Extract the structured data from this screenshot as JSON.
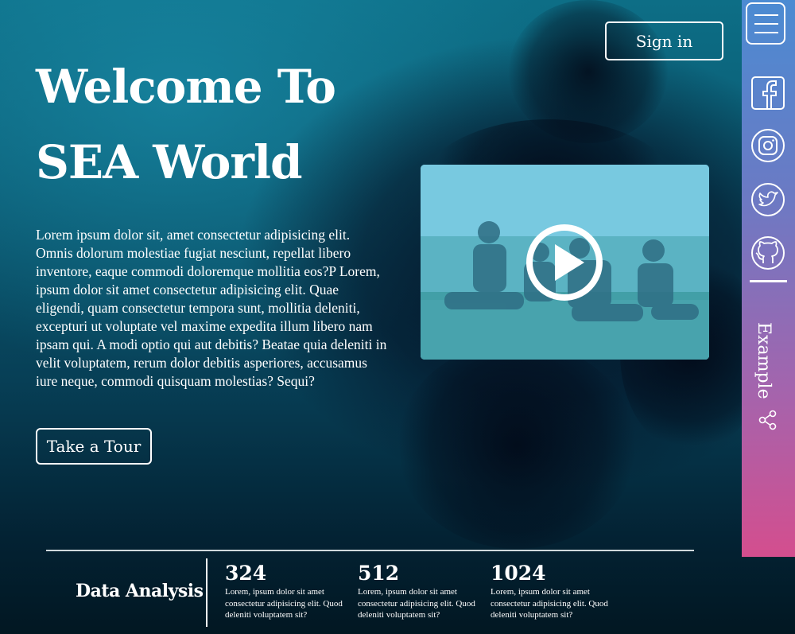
{
  "hero": {
    "title_line1": "Welcome To",
    "title_line2": "SEA World",
    "description": "Lorem ipsum dolor sit, amet consectetur adipisicing elit. Omnis dolorum molestiae fugiat nesciunt, repellat libero inventore, eaque commodi doloremque mollitia eos?P Lorem, ipsum dolor sit amet consectetur adipisicing elit. Quae eligendi, quam consectetur tempora sunt, mollitia deleniti, excepturi ut voluptate vel maxime expedita illum libero nam ipsam qui. A modi optio qui aut debitis? Beatae quia deleniti in velit voluptatem, rerum dolor debitis asperiores, accusamus iure neque, commodi quisquam molestias? Sequi?",
    "tour_label": "Take a Tour"
  },
  "header": {
    "signin_label": "Sign in"
  },
  "video": {
    "play_icon": "play-icon"
  },
  "sidebar": {
    "menu_icon": "hamburger-menu-icon",
    "social": [
      "facebook-icon",
      "instagram-icon",
      "twitter-icon",
      "github-icon"
    ],
    "label": "Example",
    "share_icon": "share-icon",
    "gradient": [
      "#4b8bd2",
      "#d44e8e"
    ]
  },
  "analysis": {
    "title": "Data Analysis",
    "stats": [
      {
        "value": "324",
        "text": "Lorem, ipsum dolor sit amet consectetur adipisicing elit. Quod deleniti voluptatem sit?"
      },
      {
        "value": "512",
        "text": "Lorem, ipsum dolor sit amet consectetur adipisicing elit. Quod deleniti voluptatem sit?"
      },
      {
        "value": "1024",
        "text": "Lorem, ipsum dolor sit amet consectetur adipisicing elit. Quod deleniti voluptatem sit?"
      }
    ]
  }
}
